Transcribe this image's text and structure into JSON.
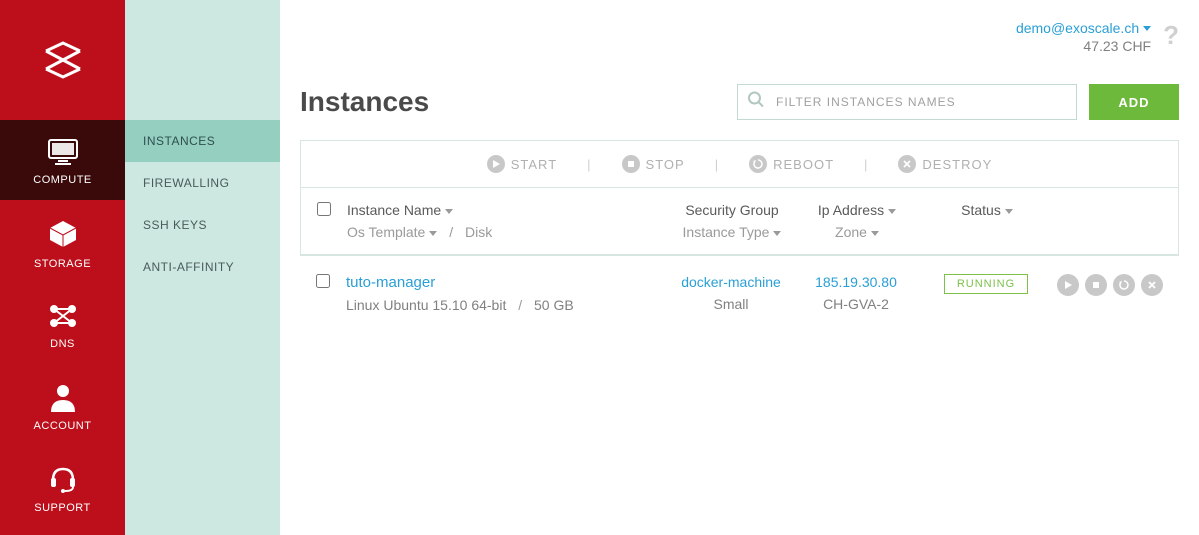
{
  "user": {
    "email": "demo@exoscale.ch",
    "balance": "47.23 CHF"
  },
  "nav": {
    "items": [
      {
        "label": "COMPUTE"
      },
      {
        "label": "STORAGE"
      },
      {
        "label": "DNS"
      },
      {
        "label": "ACCOUNT"
      },
      {
        "label": "SUPPORT"
      }
    ]
  },
  "subnav": {
    "items": [
      {
        "label": "INSTANCES"
      },
      {
        "label": "FIREWALLING"
      },
      {
        "label": "SSH KEYS"
      },
      {
        "label": "ANTI-AFFINITY"
      }
    ]
  },
  "page": {
    "title": "Instances",
    "filter_placeholder": "FILTER INSTANCES NAMES",
    "add_label": "ADD"
  },
  "bulk": {
    "start": "START",
    "stop": "STOP",
    "reboot": "REBOOT",
    "destroy": "DESTROY"
  },
  "columns": {
    "name": "Instance Name",
    "os": "Os Template",
    "disk": "Disk",
    "sg": "Security Group",
    "type": "Instance Type",
    "ip": "Ip Address",
    "zone": "Zone",
    "status": "Status"
  },
  "instances": [
    {
      "name": "tuto-manager",
      "os": "Linux Ubuntu 15.10 64-bit",
      "disk": "50 GB",
      "sg": "docker-machine",
      "type": "Small",
      "ip": "185.19.30.80",
      "zone": "CH-GVA-2",
      "status": "RUNNING"
    }
  ]
}
